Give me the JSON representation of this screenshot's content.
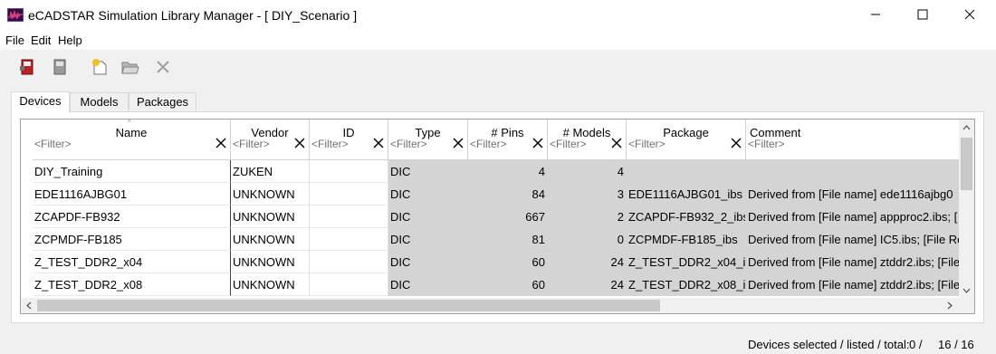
{
  "window": {
    "title": "eCADSTAR Simulation Library Manager - [ DIY_Scenario ]",
    "app_icon": "ecadstar-waveform-icon"
  },
  "menu": [
    "File",
    "Edit",
    "Help"
  ],
  "toolbar": {
    "icons": [
      "library-red-icon",
      "library-gray-icon",
      "new-file-icon",
      "open-folder-icon",
      "delete-x-icon"
    ]
  },
  "tabs": [
    {
      "label": "Devices",
      "active": true
    },
    {
      "label": "Models",
      "active": false
    },
    {
      "label": "Packages",
      "active": false
    }
  ],
  "grid": {
    "filter_placeholder": "<Filter>",
    "columns": [
      "Name",
      "Vendor",
      "ID",
      "Type",
      "# Pins",
      "# Models",
      "Package",
      "Comment"
    ],
    "rows": [
      [
        "DIY_Training",
        "ZUKEN",
        "",
        "DIC",
        "4",
        "4",
        "",
        ""
      ],
      [
        "EDE1116AJBG01",
        "UNKNOWN",
        "",
        "DIC",
        "84",
        "3",
        "EDE1116AJBG01_ibs",
        "Derived from [File name] ede1116ajbg0"
      ],
      [
        "ZCAPDF-FB932",
        "UNKNOWN",
        "",
        "DIC",
        "667",
        "2",
        "ZCAPDF-FB932_2_ibs",
        "Derived from [File name] appproc2.ibs; ["
      ],
      [
        "ZCPMDF-FB185",
        "UNKNOWN",
        "",
        "DIC",
        "81",
        "0",
        "ZCPMDF-FB185_ibs",
        "Derived from [File name] IC5.ibs; [File Re"
      ],
      [
        "Z_TEST_DDR2_x04",
        "UNKNOWN",
        "",
        "DIC",
        "60",
        "24",
        "Z_TEST_DDR2_x04_i...",
        "Derived from [File name] ztddr2.ibs; [File"
      ],
      [
        "Z_TEST_DDR2_x08",
        "UNKNOWN",
        "",
        "DIC",
        "60",
        "24",
        "Z_TEST_DDR2_x08_i...",
        "Derived from [File name] ztddr2.ibs; [File"
      ]
    ]
  },
  "status": {
    "label": "Devices selected / listed / total:",
    "selected": "0 /",
    "listed_total": "16 / 16"
  }
}
